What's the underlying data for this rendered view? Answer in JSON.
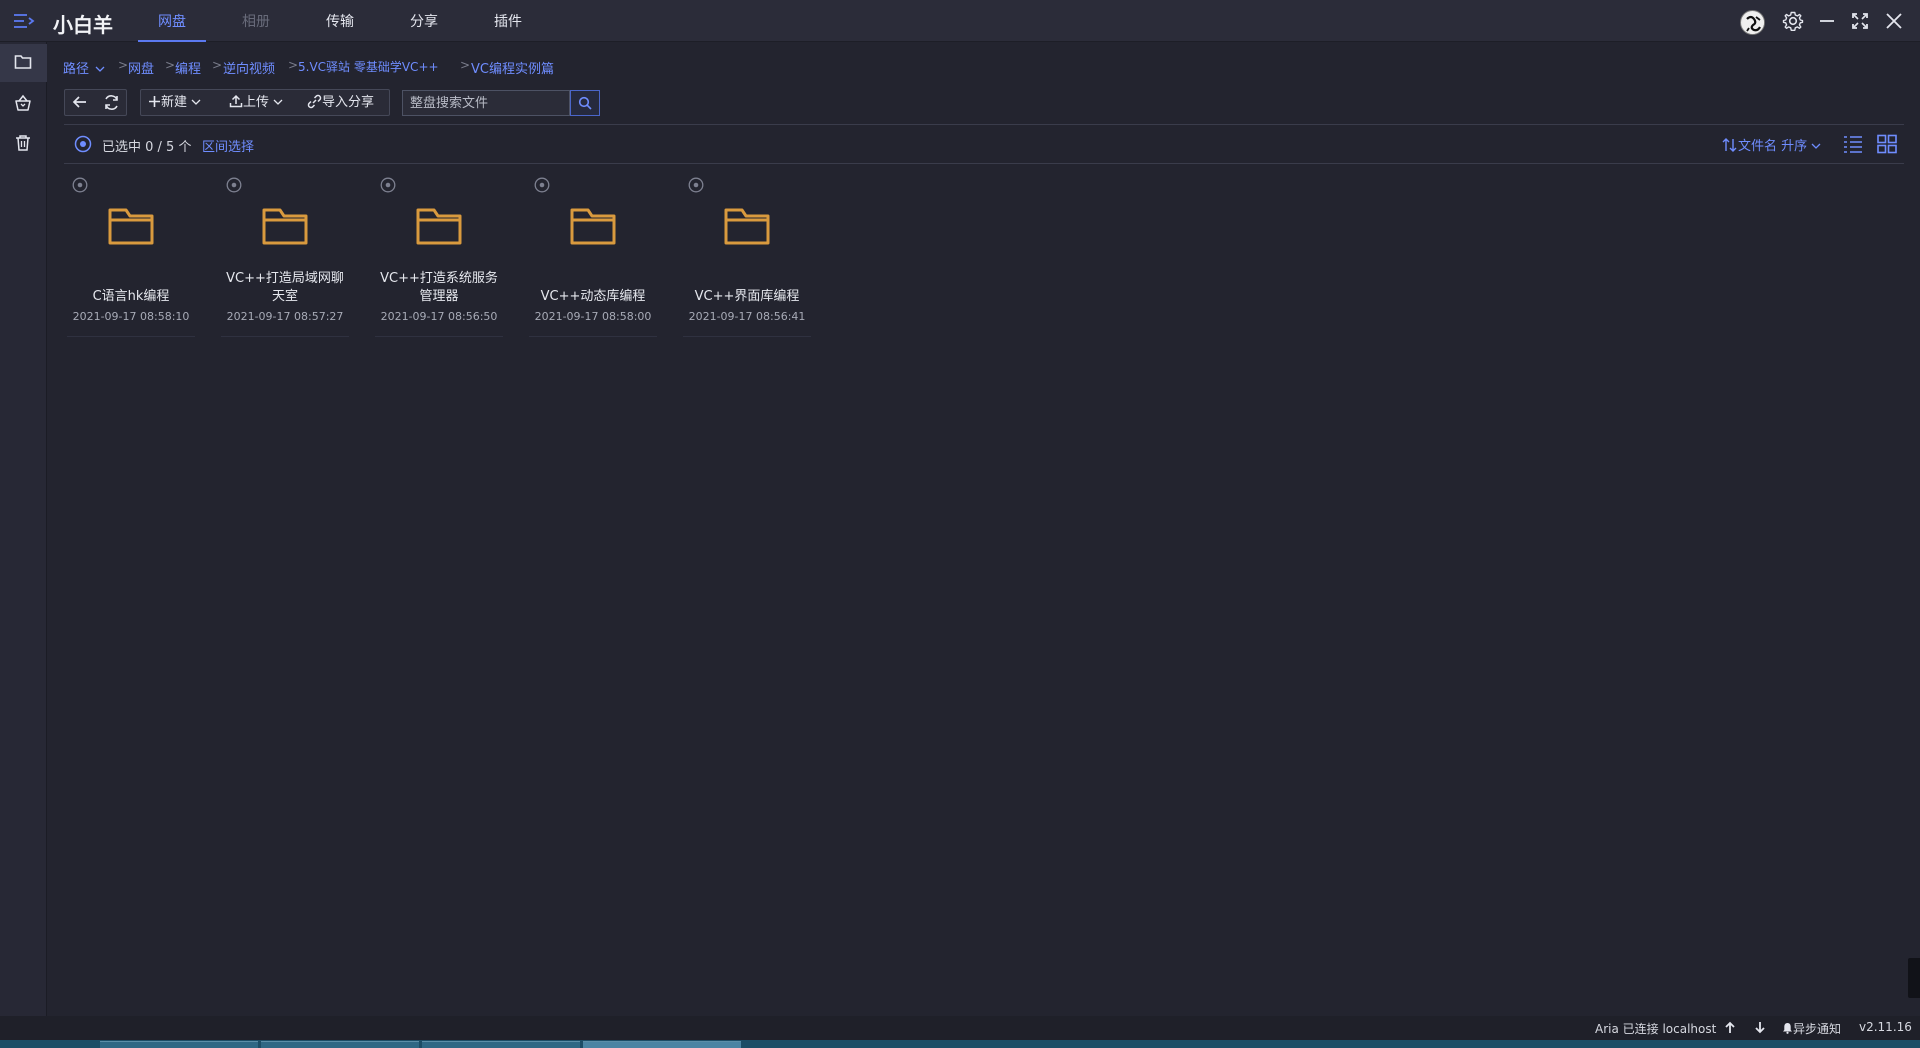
{
  "app": {
    "title": "小白羊"
  },
  "nav": {
    "tabs": [
      {
        "label": "网盘",
        "state": "active"
      },
      {
        "label": "相册",
        "state": "disabled"
      },
      {
        "label": "传输",
        "state": "normal"
      },
      {
        "label": "分享",
        "state": "normal"
      },
      {
        "label": "插件",
        "state": "normal"
      }
    ]
  },
  "window_controls": [
    "avatar",
    "gear-icon",
    "minimize-icon",
    "maximize-icon",
    "close-icon"
  ],
  "sidebar": {
    "items": [
      "folder-icon",
      "recycle-basket-icon",
      "trash-icon"
    ]
  },
  "breadcrumb": {
    "items": [
      "路径",
      "网盘",
      "编程",
      "逆向视频",
      "5.VC驿站 零基础学VC++",
      "VC编程实例篇"
    ],
    "separator": ">"
  },
  "toolbar": {
    "new_label": "新建",
    "upload_label": "上传",
    "import_share_label": "导入分享",
    "search_placeholder": "整盘搜索文件"
  },
  "selection": {
    "text": "已选中 0 / 5 个",
    "range_link": "区间选择"
  },
  "sort": {
    "label": "文件名 升序"
  },
  "files": [
    {
      "name": "C语言hk编程",
      "date": "2021-09-17 08:58:10"
    },
    {
      "name": "VC++打造局域网聊天室",
      "date": "2021-09-17 08:57:27"
    },
    {
      "name": "VC++打造系统服务管理器",
      "date": "2021-09-17 08:56:50"
    },
    {
      "name": "VC++动态库编程",
      "date": "2021-09-17 08:58:00"
    },
    {
      "name": "VC++界面库编程",
      "date": "2021-09-17 08:56:41"
    }
  ],
  "status": {
    "aria": "Aria 已连接 localhost",
    "notify": "异步通知",
    "version": "v2.11.16"
  },
  "colors": {
    "background": "#23242f",
    "accent": "#6f8dff",
    "folder": "#d99a3e",
    "taskbar": "#1c4d66"
  }
}
